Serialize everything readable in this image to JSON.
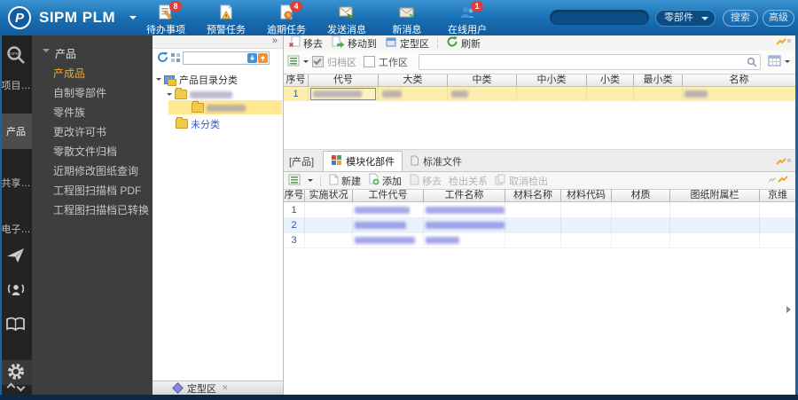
{
  "topbar": {
    "logo_text": "SIPM PLM",
    "icons": [
      {
        "label": "待办事项",
        "badge": "8"
      },
      {
        "label": "预警任务"
      },
      {
        "label": "逾期任务",
        "badge": "4"
      },
      {
        "label": "发送消息"
      },
      {
        "label": "新消息"
      },
      {
        "label": "在线用户",
        "badge": "1"
      }
    ],
    "search_category": "零部件",
    "search_button": "搜索",
    "advanced_button": "高级"
  },
  "sidebar": {
    "tabs": [
      "项目…",
      "产品",
      "共享…",
      "电子…"
    ],
    "active_tab": "产品"
  },
  "menu": {
    "header": "产品",
    "selected": "产成品",
    "items": [
      "产成品",
      "自制零部件",
      "零件族",
      "更改许可书",
      "零散文件归档",
      "近期修改图纸查询",
      "工程图扫描档 PDF",
      "工程图扫描档已转换"
    ]
  },
  "tree": {
    "collapse_glyph": "»",
    "root": "产品目录分类",
    "unclassified": "未分类",
    "bottom_bar": "定型区"
  },
  "products": {
    "toolbar": [
      "移去",
      "移动到",
      "定型区",
      "刷新"
    ],
    "filters": {
      "archive": "归档区",
      "workspace": "工作区",
      "archive_checked": true,
      "workspace_checked": false
    },
    "columns": [
      "序号",
      "代号",
      "大类",
      "中类",
      "中小类",
      "小类",
      "最小类",
      "名称"
    ],
    "rows": [
      {
        "seq": "1"
      }
    ]
  },
  "bom": {
    "tabs": [
      "[产品]",
      "模块化部件",
      "标准文件"
    ],
    "active_tab": "模块化部件",
    "toolbar": [
      {
        "label": "新建",
        "enabled": true
      },
      {
        "label": "添加",
        "enabled": true
      },
      {
        "label": "移去",
        "enabled": false
      },
      {
        "label": "检出关系",
        "enabled": false
      },
      {
        "label": "取消检出",
        "enabled": false
      }
    ],
    "columns": [
      "序号",
      "实施状况",
      "工件代号",
      "工件名称",
      "材料名称",
      "材料代码",
      "材质",
      "图纸附属栏",
      "京维"
    ],
    "rows": [
      {
        "seq": "1"
      },
      {
        "seq": "2"
      },
      {
        "seq": "3"
      }
    ]
  },
  "colors": {
    "accent_blue": "#1566a8",
    "selection_yellow": "#fcefae",
    "highlight_orange": "#f5a623",
    "badge_red": "#e23b3b",
    "footer_navy": "#0b2946"
  }
}
